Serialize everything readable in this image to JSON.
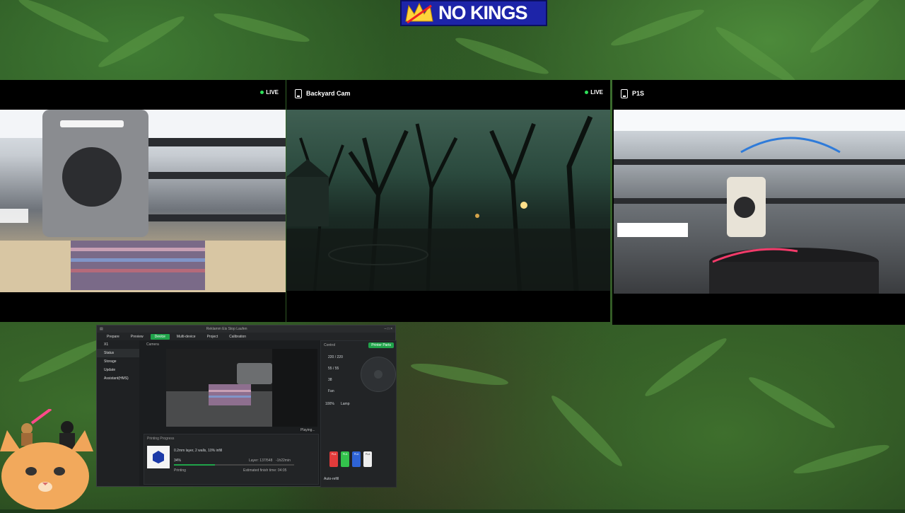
{
  "banner": {
    "text": "NO KINGS",
    "background": "#1d24a8",
    "crown_color": "#ffd43b"
  },
  "cameras": [
    {
      "title": "",
      "status": "LIVE"
    },
    {
      "title": "Backyard Cam",
      "status": "LIVE"
    },
    {
      "title": "P1S",
      "status": ""
    }
  ],
  "app": {
    "title": "Reklamm Eis Stop Laufen",
    "tabs": [
      "Prepare",
      "Preview",
      "Device",
      "Multi-device",
      "Project",
      "Calibration"
    ],
    "active_tab": "Device",
    "sidebar": [
      "X1",
      "Status",
      "Storage",
      "Update",
      "Assistant(HMS)"
    ],
    "video_label": "Camera",
    "playing": "Playing...",
    "progress_title": "Printing Progress",
    "job": "0.2mm layer, 2 walls, 10% infill",
    "percent": "34%",
    "layer": "Layer: 137/548",
    "time": "-1h22min",
    "state": "Printing",
    "finish": "Estimated finish time: 04:05",
    "control": {
      "title": "Control",
      "button": "Printer Parts",
      "nozzle": "220 / 220",
      "bed": "55 / 55",
      "chamber": "38",
      "fan": "Fan",
      "speed": "100%",
      "lamp": "Lamp",
      "auto_refill": "Auto-refill",
      "spools": [
        {
          "label": "PLA",
          "color": "#e23b3b"
        },
        {
          "label": "PLA",
          "color": "#33c24c"
        },
        {
          "label": "PLA",
          "color": "#2e63d6"
        },
        {
          "label": "PLA",
          "color": "#eeeeee"
        }
      ]
    }
  }
}
